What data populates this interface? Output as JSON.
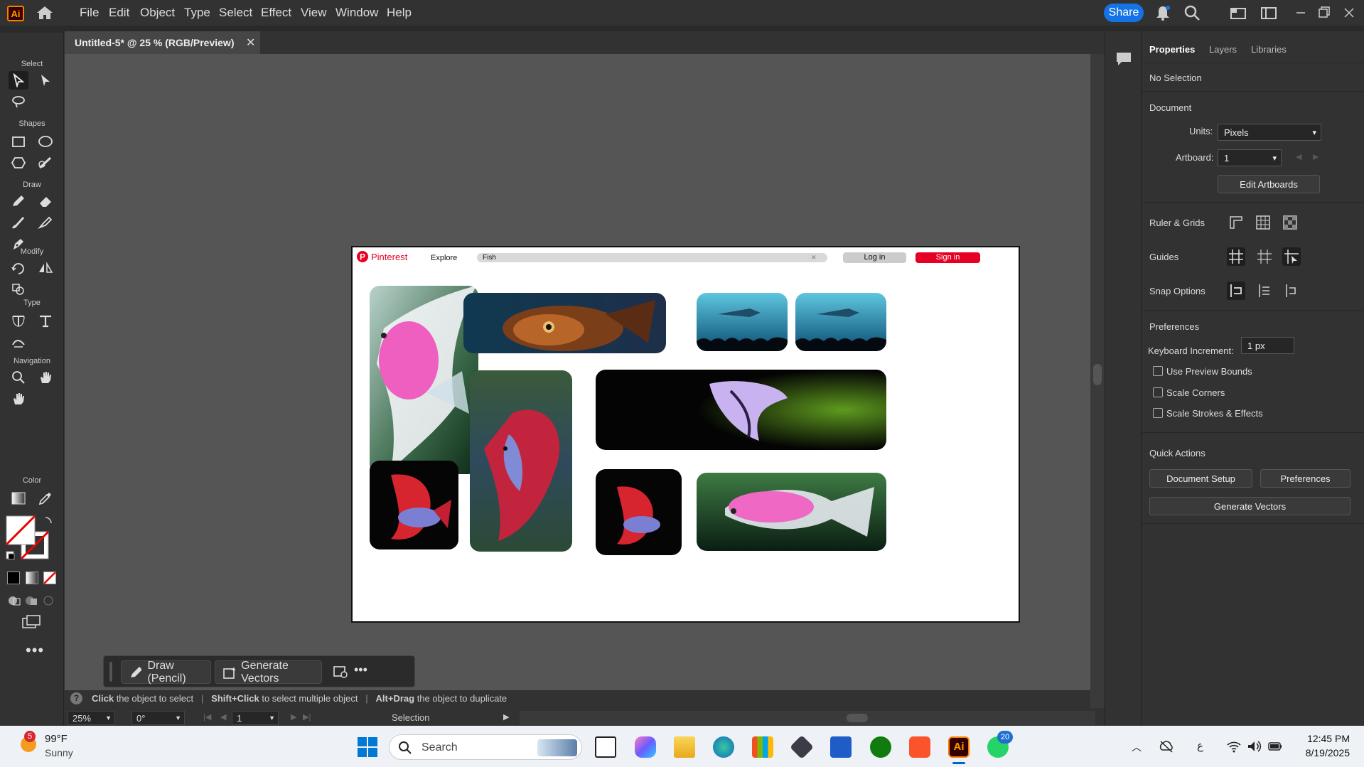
{
  "menubar": {
    "app_logo": "Ai",
    "items": [
      "File",
      "Edit",
      "Object",
      "Type",
      "Select",
      "Effect",
      "View",
      "Window",
      "Help"
    ],
    "share_label": "Share"
  },
  "document_tab": {
    "title": "Untitled-5* @ 25 % (RGB/Preview)"
  },
  "toolbar": {
    "sections": {
      "select": "Select",
      "shapes": "Shapes",
      "draw": "Draw",
      "modify": "Modify",
      "type": "Type",
      "navigation": "Navigation",
      "color": "Color"
    }
  },
  "artboard": {
    "header": {
      "brand": "Pinterest",
      "explore": "Explore",
      "search_value": "Fish",
      "login_label": "Log in",
      "signin_label": "Sign in"
    },
    "accent_color": "#e60023"
  },
  "context_bar": {
    "draw_label": "Draw (Pencil)",
    "generate_label": "Generate Vectors"
  },
  "status": {
    "hint1_b": "Click",
    "hint1": " the object to select",
    "hint2_b": "Shift+Click",
    "hint2": " to select multiple object",
    "hint3_b": "Alt+Drag",
    "hint3": " the object to duplicate"
  },
  "bottombar": {
    "zoom": "25%",
    "rotation": "0°",
    "artboard_num": "1",
    "tool": "Selection"
  },
  "properties_panel": {
    "tabs": [
      "Properties",
      "Layers",
      "Libraries"
    ],
    "selection": "No Selection",
    "document_title": "Document",
    "units_label": "Units:",
    "units_value": "Pixels",
    "artboard_label": "Artboard:",
    "artboard_value": "1",
    "edit_artboards": "Edit Artboards",
    "ruler_grids": "Ruler & Grids",
    "guides": "Guides",
    "snap_options": "Snap Options",
    "preferences_title": "Preferences",
    "keyboard_increment_label": "Keyboard Increment:",
    "keyboard_increment_value": "1 px",
    "use_preview_bounds": "Use Preview Bounds",
    "scale_corners": "Scale Corners",
    "scale_strokes": "Scale Strokes & Effects",
    "quick_actions": "Quick Actions",
    "document_setup": "Document Setup",
    "preferences_btn": "Preferences",
    "generate_vectors": "Generate Vectors"
  },
  "taskbar": {
    "weather_temp": "99°F",
    "weather_cond": "Sunny",
    "weather_badge": "5",
    "search_label": "Search",
    "whatsapp_badge": "20",
    "lang": "ع",
    "time": "12:45 PM",
    "date": "8/19/2025"
  }
}
